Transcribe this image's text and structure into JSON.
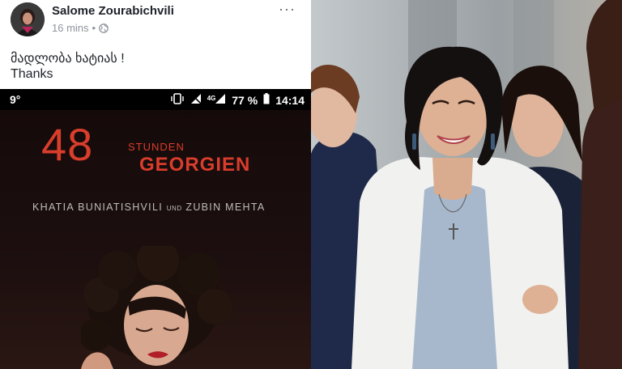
{
  "post": {
    "author": "Salome Zourabichvili",
    "time": "16 mins",
    "separator": "•",
    "more": "···",
    "text_line1": "მადლობა ხატიას !",
    "text_line2": "Thanks",
    "icons": {
      "privacy": "globe-icon",
      "menu": "more-options-icon",
      "avatar": "profile-avatar"
    }
  },
  "phone": {
    "status": {
      "temperature": "9°",
      "network": "4G",
      "battery_percent": "77 %",
      "time": "14:14",
      "icons": [
        "vibrate-icon",
        "no-signal-icon",
        "signal-icon",
        "battery-icon"
      ]
    },
    "poster": {
      "number": "48",
      "line1": "STUNDEN",
      "line2": "GEORGIEN",
      "artist1": "KHATIA BUNIATISHVILI",
      "conjunction": "UND",
      "artist2": "ZUBIN MEHTA"
    }
  },
  "colors": {
    "poster_red": "#d93d2b",
    "fb_text": "#1d2129",
    "fb_meta": "#90949c"
  }
}
